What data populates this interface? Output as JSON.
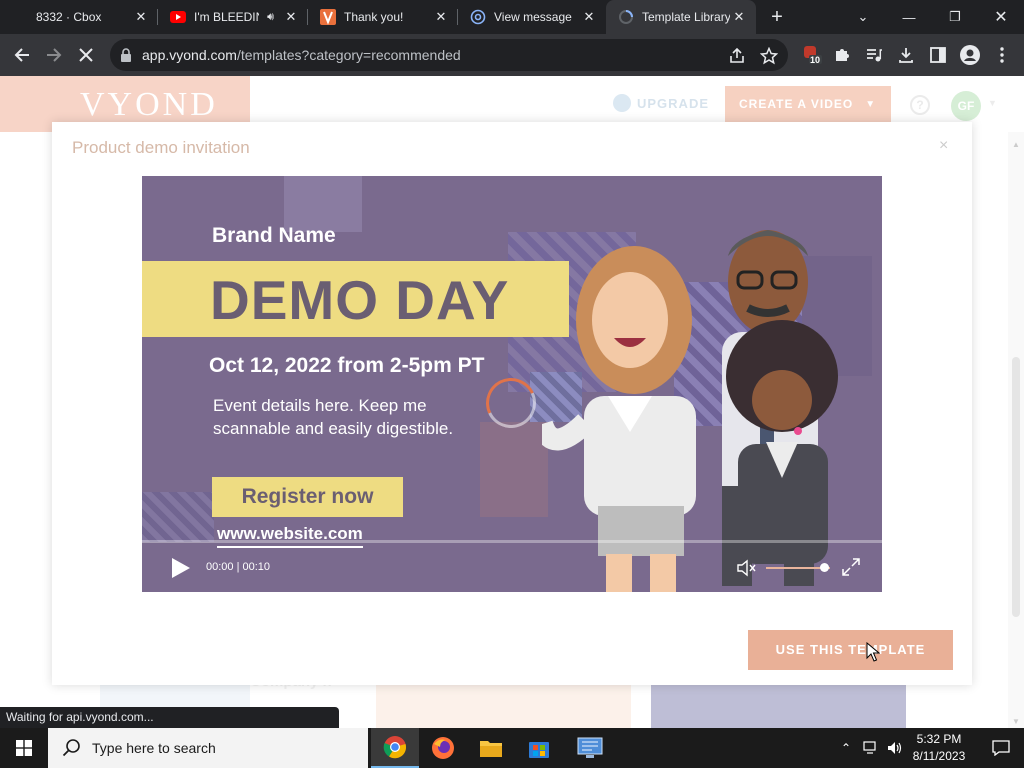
{
  "browser": {
    "tabs": [
      {
        "title": "8332 · Cbox",
        "active": false
      },
      {
        "title": "I'm BLEEDIN",
        "active": false,
        "audio": true
      },
      {
        "title": "Thank you!",
        "active": false
      },
      {
        "title": "View message",
        "active": false
      },
      {
        "title": "Template Library",
        "active": true
      }
    ],
    "url_host": "app.vyond.com",
    "url_path": "/templates?category=recommended",
    "extension_badge": "10",
    "status_text": "Waiting for api.vyond.com..."
  },
  "site": {
    "logo": "VYOND",
    "upgrade_label": "UPGRADE",
    "create_label": "CREATE A VIDEO",
    "help_label": "?",
    "avatar_initials": "GF",
    "bg_text": "Company n"
  },
  "modal": {
    "title": "Product demo invitation",
    "close_label": "×",
    "video": {
      "brand": "Brand Name",
      "headline": "DEMO DAY",
      "date": "Oct 12, 2022 from 2-5pm PT",
      "details": "Event details here. Keep me scannable and easily digestible.",
      "register": "Register now",
      "website": "www.website.com",
      "time": "00:00 | 00:10",
      "progress": 0.0,
      "volume": 0.9
    },
    "use_button": "USE THIS TEMPLATE"
  },
  "taskbar": {
    "search_placeholder": "Type here to search",
    "time": "5:32 PM",
    "date": "8/11/2023"
  },
  "colors": {
    "accent": "#e9b097",
    "banner": "#eedc82",
    "video_bg": "#7a6a8e"
  }
}
